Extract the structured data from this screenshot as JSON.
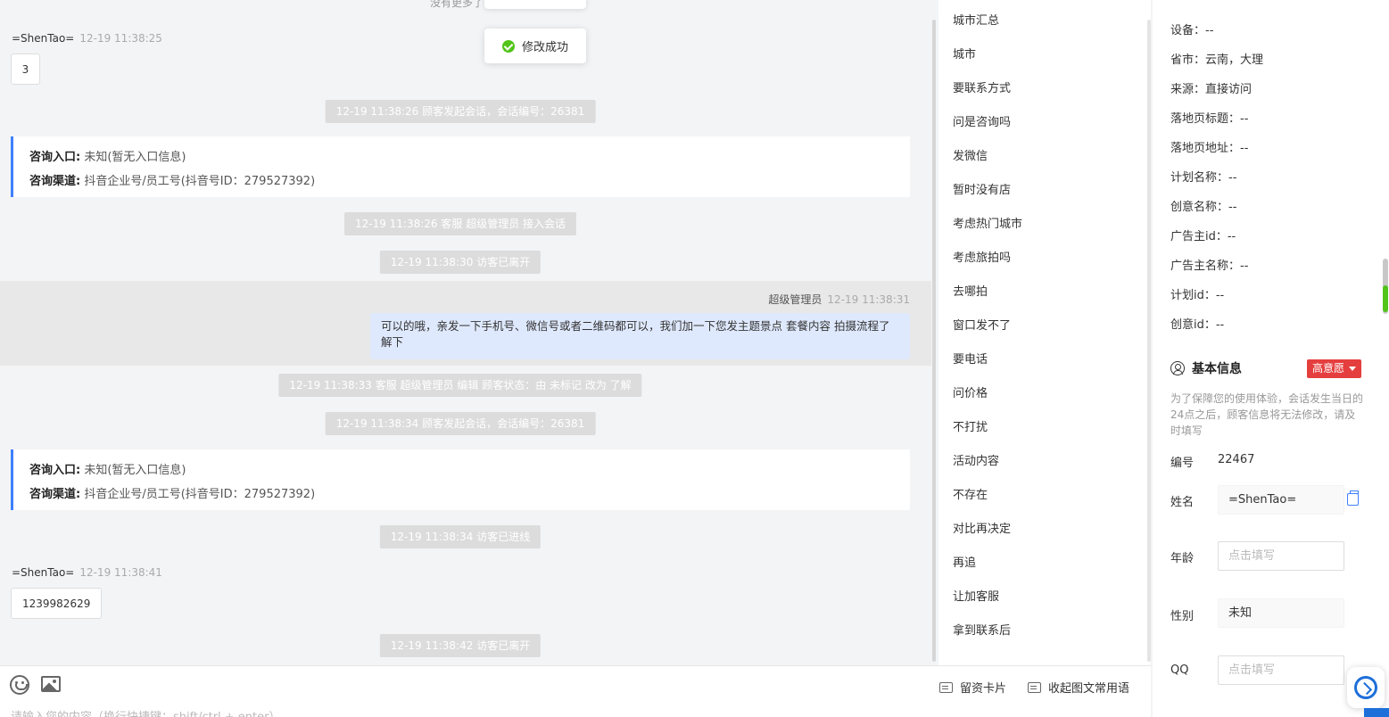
{
  "chat": {
    "no_more": "没有更多了",
    "toast": "修改成功",
    "messages": [
      {
        "sender": "=ShenTao=",
        "time": "12-19 11:38:25",
        "text": "3"
      },
      {
        "sender": "=ShenTao=",
        "time": "12-19 11:38:41",
        "text": "1239982629"
      }
    ],
    "system": [
      "12-19 11:38:26 顾客发起会话，会话编号：26381",
      "12-19 11:38:26 客服 超级管理员 接入会话",
      "12-19 11:38:30 访客已离开",
      "12-19 11:38:33 客服 超级管理员 编辑 顾客状态：由 未标记 改为 了解",
      "12-19 11:38:34 顾客发起会话，会话编号：26381",
      "12-19 11:38:34 访客已进线",
      "12-19 11:38:42 访客已离开"
    ],
    "info_cards": [
      {
        "entry_label": "咨询入口:",
        "entry_value": "未知(暂无入口信息)",
        "channel_label": "咨询渠道:",
        "channel_value": "抖音企业号/员工号(抖音号ID：279527392)"
      },
      {
        "entry_label": "咨询入口:",
        "entry_value": "未知(暂无入口信息)",
        "channel_label": "咨询渠道:",
        "channel_value": "抖音企业号/员工号(抖音号ID：279527392)"
      }
    ],
    "agent": {
      "name": "超级管理员",
      "time": "12-19 11:38:31",
      "text": "可以的哦，亲发一下手机号、微信号或者二维码都可以，我们加一下您发主题景点 套餐内容 拍摄流程了解下"
    }
  },
  "input": {
    "placeholder": "请输入您的内容（换行快捷键：shift/ctrl + enter）",
    "leave_card": "留资卡片",
    "collapse_phrases": "收起图文常用语"
  },
  "phrases": [
    "城市汇总",
    "城市",
    "要联系方式",
    "问是咨询吗",
    "发微信",
    "暂时没有店",
    "考虑热门城市",
    "考虑旅拍吗",
    "去哪拍",
    "窗口发不了",
    "要电话",
    "问价格",
    "不打扰",
    "活动内容",
    "不存在",
    "对比再决定",
    "再追",
    "让加客服",
    "拿到联系后"
  ],
  "info": {
    "rows": [
      "设备：--",
      "省市：云南，大理",
      "来源：直接访问",
      "落地页标题：--",
      "落地页地址：--",
      "计划名称：--",
      "创意名称：--",
      "广告主id：--",
      "广告主名称：--",
      "计划id：--",
      "创意id：--"
    ],
    "basic_title": "基本信息",
    "intent": "高意愿",
    "notice": "为了保障您的使用体验，会话发生当日的24点之后，顾客信息将无法修改，请及时填写",
    "id_label": "编号",
    "id_value": "22467",
    "name_label": "姓名",
    "name_value": "=ShenTao=",
    "age_label": "年龄",
    "age_placeholder": "点击填写",
    "gender_label": "性别",
    "gender_value": "未知",
    "qq_label": "QQ",
    "qq_placeholder": "点击填写"
  },
  "colors": {
    "accent": "#3f7fff",
    "agent_bubble": "#dfe9fd",
    "intent_badge": "#e53e3e",
    "success": "#52c41a"
  }
}
